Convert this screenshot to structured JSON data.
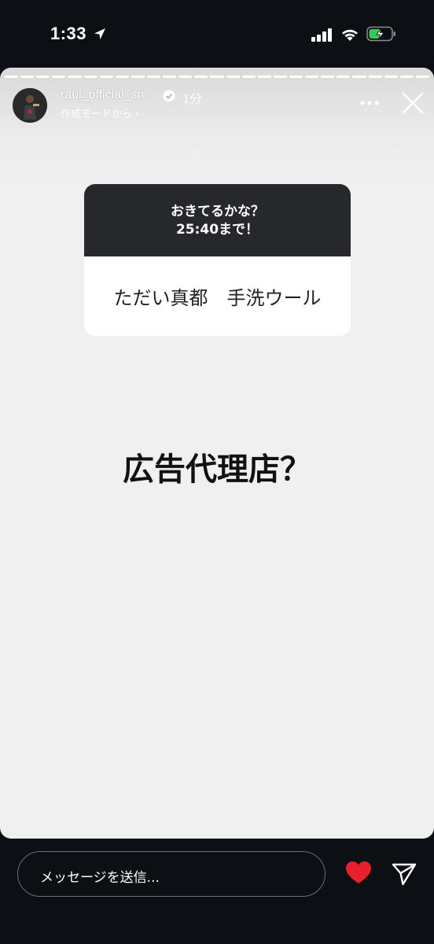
{
  "status_bar": {
    "time": "1:33"
  },
  "story": {
    "username": "raul_official_sn",
    "time_ago": "1分",
    "subline": "作成モードから",
    "question_sticker": {
      "prompt_line1": "おきてるかな？",
      "prompt_line2": "25:40まで！",
      "answer": "ただい真都　手洗ウール"
    },
    "main_text": "広告代理店？"
  },
  "footer": {
    "message_placeholder": "メッセージを送信..."
  },
  "colors": {
    "background": "#0c0f14",
    "story_bg": "#f0f0f0",
    "sticker_header": "#26282c",
    "heart": "#e8202e",
    "battery_charge": "#35c759"
  },
  "icons": [
    "location-arrow-icon",
    "signal-icon",
    "wifi-icon",
    "battery-charging-icon",
    "verified-badge-icon",
    "more-icon",
    "close-icon",
    "heart-icon",
    "send-icon"
  ]
}
